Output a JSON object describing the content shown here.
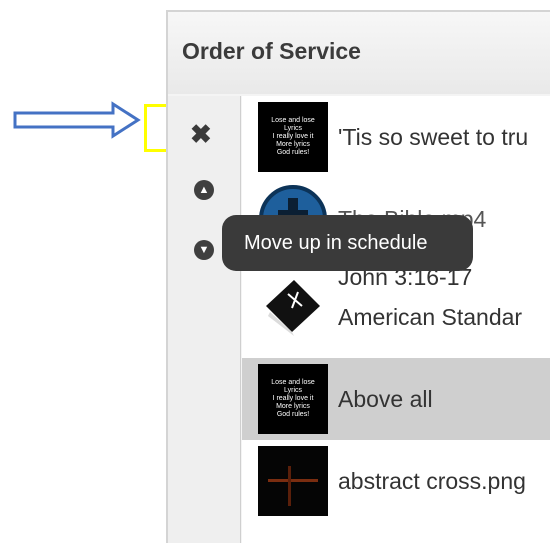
{
  "panel": {
    "title": "Order of Service",
    "items": [
      {
        "thumb_lines": [
          "Lose and lose",
          "Lyrics",
          "I really love it",
          "More lyrics",
          "God rules!"
        ],
        "label": "'Tis so sweet to tru",
        "label2": ""
      },
      {
        "label": "The Bible.mp4",
        "label2": ""
      },
      {
        "label": "John 3:16-17",
        "label2": "American Standar"
      },
      {
        "thumb_lines": [
          "Lose and lose",
          "Lyrics",
          "I really love it",
          "More lyrics",
          "God rules!"
        ],
        "label": "Above all",
        "label2": ""
      },
      {
        "label": "abstract cross.png",
        "label2": ""
      }
    ]
  },
  "tooltip": {
    "text": "Move up in schedule"
  },
  "colors": {
    "selected_row": "#cfcfcf",
    "annotation_arrow": "#4472c4",
    "annotation_box": "#ffff00"
  }
}
